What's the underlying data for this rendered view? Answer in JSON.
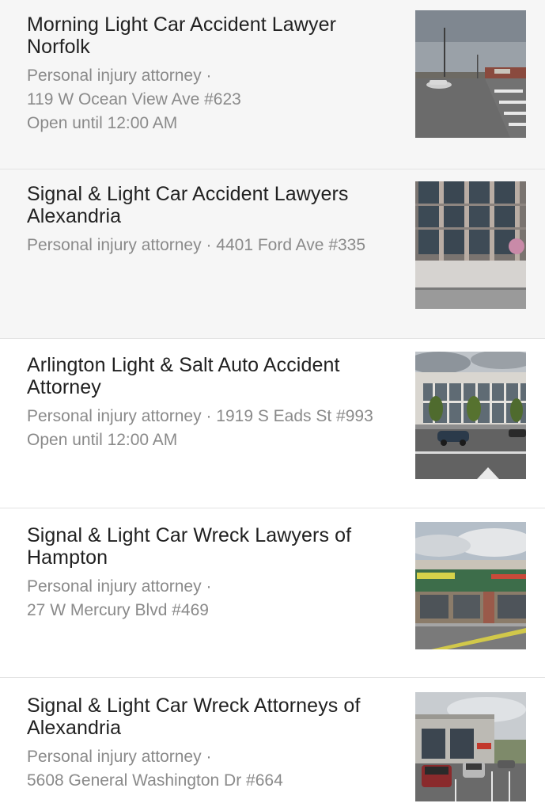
{
  "results": [
    {
      "title_line1": "Morning Light Car Accident Lawyer",
      "title_line2": "Norfolk",
      "meta_line1": "Personal injury attorney ·",
      "meta_line2": "119 W Ocean View Ave #623",
      "meta_line3": "Open until 12:00 AM",
      "thumbnail": "street-intersection-photo"
    },
    {
      "title_line1": "Signal & Light Car Accident Lawyers",
      "title_line2": "Alexandria",
      "meta_line1": "Personal injury attorney · 4401 Ford Ave #335",
      "meta_line2": "",
      "meta_line3": "",
      "thumbnail": "office-building-photo"
    },
    {
      "title_line1": "Arlington Light & Salt Auto Accident",
      "title_line2": "Attorney",
      "meta_line1": "Personal injury attorney · 1919 S Eads St #993",
      "meta_line2": "Open until 12:00 AM",
      "meta_line3": "",
      "thumbnail": "glass-office-building-photo"
    },
    {
      "title_line1": "Signal & Light Car Wreck Lawyers of",
      "title_line2": "Hampton",
      "meta_line1": "Personal injury attorney ·",
      "meta_line2": "27 W Mercury Blvd #469",
      "meta_line3": "",
      "thumbnail": "shopping-plaza-photo"
    },
    {
      "title_line1": "Signal & Light Car Wreck Attorneys of",
      "title_line2": "Alexandria",
      "meta_line1": "Personal injury attorney ·",
      "meta_line2": "5608 General Washington Dr #664",
      "meta_line3": "",
      "thumbnail": "parking-lot-building-photo"
    }
  ]
}
